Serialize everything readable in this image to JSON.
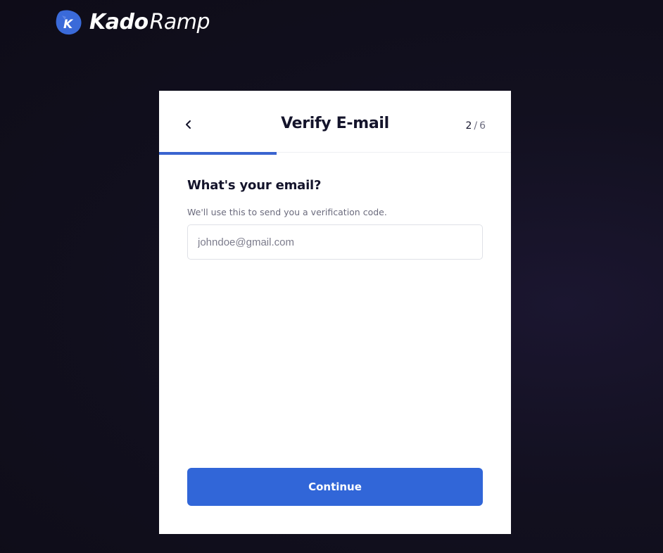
{
  "brand": {
    "logo_icon": "kado-k-logo",
    "name_bold": "Kado",
    "name_light": "Ramp"
  },
  "header": {
    "back_icon": "chevron-left-icon",
    "title": "Verify E-mail",
    "step_current": "2",
    "step_separator": "/",
    "step_total": "6",
    "progress_fraction": 0.333
  },
  "form": {
    "question": "What's your email?",
    "helper": "We'll use this to send you a verification code.",
    "email": {
      "value": "",
      "placeholder": "johndoe@gmail.com"
    },
    "continue_label": "Continue"
  },
  "colors": {
    "accent": "#3166d8",
    "progress": "#3a64d0",
    "background": "#12101f",
    "card": "#ffffff",
    "text_primary": "#14142b"
  }
}
